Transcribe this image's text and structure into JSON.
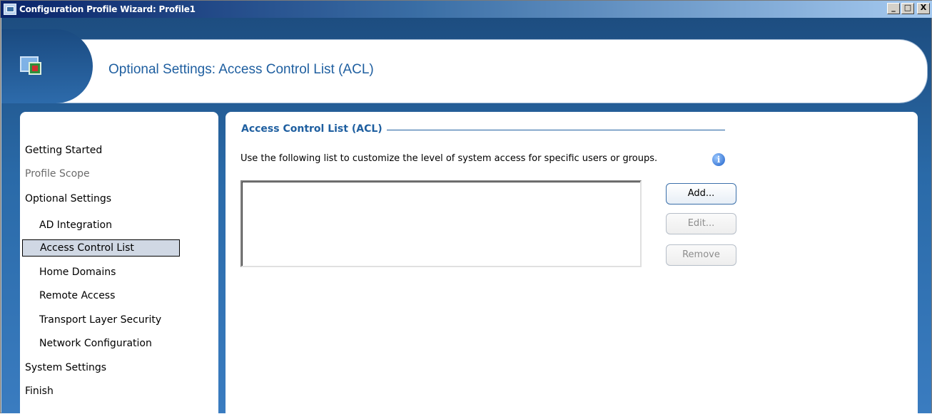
{
  "window": {
    "title": "Configuration Profile Wizard: Profile1",
    "buttons": {
      "minimize": "_",
      "maximize": "□",
      "close": "X"
    }
  },
  "header": {
    "title": "Optional Settings: Access Control List (ACL)"
  },
  "sidebar": {
    "items": [
      {
        "label": "Getting Started",
        "state": "normal"
      },
      {
        "label": "Profile Scope",
        "state": "disabled"
      },
      {
        "label": "Optional Settings",
        "state": "normal"
      },
      {
        "label": "AD Integration",
        "state": "normal"
      },
      {
        "label": "Access Control List",
        "state": "selected"
      },
      {
        "label": "Home Domains",
        "state": "normal"
      },
      {
        "label": "Remote Access",
        "state": "normal"
      },
      {
        "label": "Transport Layer Security",
        "state": "normal"
      },
      {
        "label": "Network Configuration",
        "state": "normal"
      },
      {
        "label": "System Settings",
        "state": "normal"
      },
      {
        "label": "Finish",
        "state": "normal"
      }
    ]
  },
  "main": {
    "section_title": "Access Control List (ACL)",
    "description": "Use the following list to customize the level of system access for specific users or groups.",
    "info_icon": "i",
    "acl_items": [],
    "buttons": {
      "add": "Add...",
      "edit": "Edit...",
      "remove": "Remove"
    }
  },
  "colors": {
    "accent": "#1f5fa0",
    "selected_bg": "#d0d8e4"
  }
}
